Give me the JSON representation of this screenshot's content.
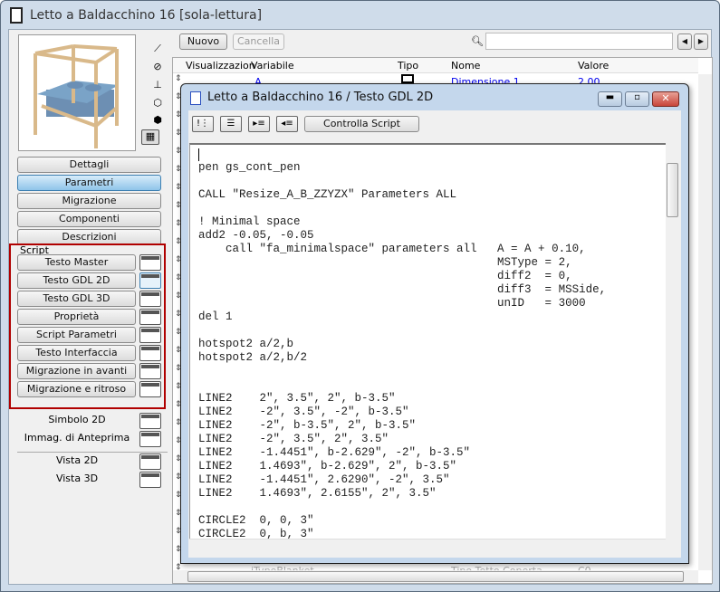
{
  "window": {
    "title": "Letto a Baldacchino 16 [sola-lettura]"
  },
  "left": {
    "tabs": [
      {
        "label": "Dettagli"
      },
      {
        "label": "Parametri",
        "selected": true
      },
      {
        "label": "Migrazione"
      },
      {
        "label": "Componenti"
      },
      {
        "label": "Descrizioni"
      }
    ],
    "script_group": "Script",
    "scripts": [
      {
        "label": "Testo Master"
      },
      {
        "label": "Testo GDL 2D"
      },
      {
        "label": "Testo GDL 3D"
      },
      {
        "label": "Proprietà"
      },
      {
        "label": "Script Parametri"
      },
      {
        "label": "Testo Interfaccia"
      },
      {
        "label": "Migrazione in avanti"
      },
      {
        "label": "Migrazione e ritroso"
      }
    ],
    "others": [
      {
        "label": "Simbolo 2D"
      },
      {
        "label": "Immag. di Anteprima"
      }
    ],
    "views": [
      {
        "label": "Vista 2D"
      },
      {
        "label": "Vista 3D"
      }
    ],
    "view_icons": [
      "2d-plan-icon",
      "section-icon",
      "elevation-icon",
      "3d-wireframe-icon",
      "3d-solid-icon",
      "preview-render-icon"
    ]
  },
  "toolbar": {
    "new": "Nuovo",
    "delete": "Cancella",
    "search_value": ""
  },
  "table": {
    "columns": [
      "Visualizzazion",
      "Variabile",
      "Tipo",
      "Nome",
      "Valore"
    ],
    "rows": [
      {
        "variable": "A",
        "name": "Dimensione 1",
        "value": "2,00"
      }
    ],
    "bottom_row": {
      "variable": "iTypeBlanket",
      "name": "Tipo Tetto Coperta",
      "value": "C0"
    }
  },
  "dialog": {
    "title": "Letto a Baldacchino 16 / Testo GDL 2D",
    "check_script": "Controlla Script",
    "code": "pen gs_cont_pen\n\nCALL \"Resize_A_B_ZZYZX\" Parameters ALL\n\n! Minimal space\nadd2 -0.05, -0.05\n    call \"fa_minimalspace\" parameters all   A = A + 0.10,\n                                            MSType = 2,\n                                            diff2  = 0,\n                                            diff3  = MSSide,\n                                            unID   = 3000\ndel 1\n\nhotspot2 a/2,b\nhotspot2 a/2,b/2\n\n\nLINE2    2\", 3.5\", 2\", b-3.5\"\nLINE2    -2\", 3.5\", -2\", b-3.5\"\nLINE2    -2\", b-3.5\", 2\", b-3.5\"\nLINE2    -2\", 3.5\", 2\", 3.5\"\nLINE2    -1.4451\", b-2.629\", -2\", b-3.5\"\nLINE2    1.4693\", b-2.629\", 2\", b-3.5\"\nLINE2    -1.4451\", 2.6290\", -2\", 3.5\"\nLINE2    1.4693\", 2.6155\", 2\", 3.5\"\n\nCIRCLE2  0, 0, 3\"\nCIRCLE2  0, b, 3\""
  },
  "colors": {
    "link": "#0000ee",
    "selected_tab": "#8fc4ea",
    "script_frame": "#b00000",
    "close": "#c8453a"
  }
}
